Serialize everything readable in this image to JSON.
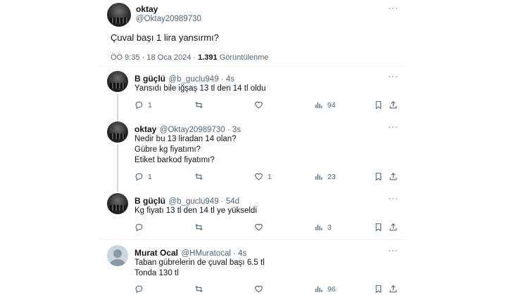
{
  "main_tweet": {
    "name": "oktay",
    "handle": "@Oktay20989730",
    "text": "Çuval başı 1 lira yansırmı?",
    "time": "ÖÖ 9:35 · 18 Oca 2024 · ",
    "views_count": "1.391",
    "views_label": " Görüntülenme"
  },
  "replies": [
    {
      "name": "B güçlü",
      "handle": "@b_guclu949 · 4s",
      "lines": [
        "Yansıdı bile iğşaş 13 tl den 14 tl oldu"
      ],
      "reply_count": "1",
      "retweet_count": "",
      "like_count": "",
      "view_count": "94"
    },
    {
      "name": "oktay",
      "handle": "@Oktay20989730 · 3s",
      "lines": [
        "Nedir bu 13 liradan 14 olan?",
        "Gübre kg fiyatımı?",
        "Etiket barkod fiyatımı?"
      ],
      "reply_count": "1",
      "retweet_count": "",
      "like_count": "1",
      "view_count": "23"
    },
    {
      "name": "B güçlü",
      "handle": "@b_guclu949 · 54d",
      "lines": [
        "Kg fiyatı 13 tl den 14 tl ye yükseldi"
      ],
      "reply_count": "",
      "retweet_count": "",
      "like_count": "",
      "view_count": "3"
    },
    {
      "name": "Murat Ocal",
      "handle": "@HMuratocal · 4s",
      "lines": [
        "Taban gübrelerin de çuval başı 6.5 tl",
        "Tonda 130 tl"
      ],
      "reply_count": "",
      "retweet_count": "",
      "like_count": "",
      "view_count": "96"
    }
  ],
  "more_label": "···"
}
